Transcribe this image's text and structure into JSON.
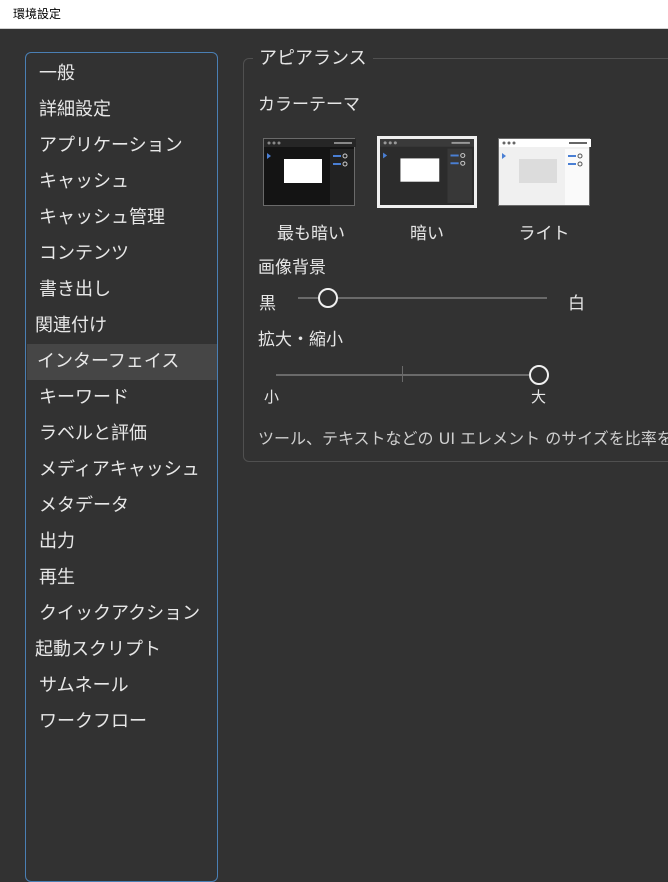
{
  "window": {
    "title": "環境設定"
  },
  "sidebar": {
    "items": [
      {
        "label": "一般"
      },
      {
        "label": "詳細設定"
      },
      {
        "label": "アプリケーション"
      },
      {
        "label": "キャッシュ"
      },
      {
        "label": "キャッシュ管理"
      },
      {
        "label": "コンテンツ"
      },
      {
        "label": "書き出し"
      },
      {
        "label": "関連付け"
      },
      {
        "label": "インターフェイス"
      },
      {
        "label": "キーワード"
      },
      {
        "label": "ラベルと評価"
      },
      {
        "label": "メディアキャッシュ"
      },
      {
        "label": "メタデータ"
      },
      {
        "label": "出力"
      },
      {
        "label": "再生"
      },
      {
        "label": "クイックアクション"
      },
      {
        "label": "起動スクリプト"
      },
      {
        "label": "サムネール"
      },
      {
        "label": "ワークフロー"
      }
    ],
    "selected": "インターフェイス"
  },
  "appearance": {
    "group_title": "アピアランス",
    "color_theme_label": "カラーテーマ",
    "themes": [
      {
        "label": "最も暗い"
      },
      {
        "label": "暗い"
      },
      {
        "label": "ライト"
      }
    ],
    "selected_theme": "暗い",
    "image_background": {
      "label": "画像背景",
      "min_label": "黒",
      "max_label": "白",
      "value_fraction": 0.12
    },
    "scale": {
      "label": "拡大・縮小",
      "min_label": "小",
      "max_label": "大",
      "value_fraction": 1.0
    },
    "description": "ツール、テキストなどの UI エレメント のサイズを比率を"
  },
  "colors": {
    "background": "#323232",
    "sidebar_border": "#4a7fb4",
    "selected_item": "#464646",
    "text": "#e6e6e6"
  }
}
